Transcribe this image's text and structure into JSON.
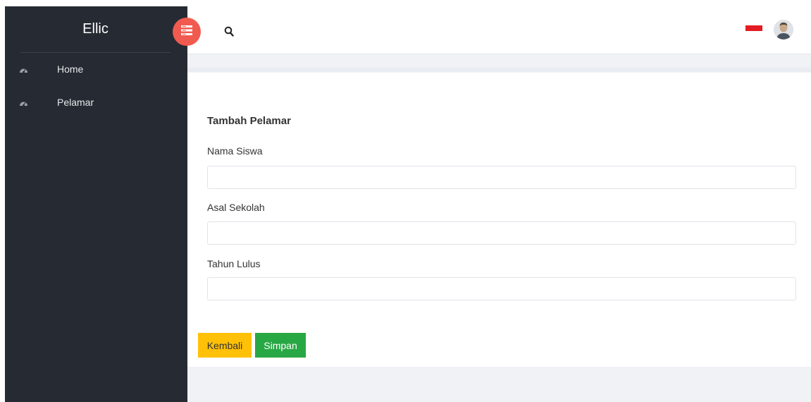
{
  "sidebar": {
    "brand": "Ellic",
    "items": [
      {
        "label": "Home",
        "icon": "dashboard-icon"
      },
      {
        "label": "Pelamar",
        "icon": "dashboard-icon"
      }
    ]
  },
  "topbar": {
    "toggle_icon": "menu-toggle-icon",
    "search_icon": "search-icon",
    "flag_icon": "flag-icon",
    "avatar_icon": "user-avatar"
  },
  "form": {
    "title": "Tambah Pelamar",
    "fields": [
      {
        "label": "Nama Siswa",
        "value": "",
        "placeholder": ""
      },
      {
        "label": "Asal Sekolah",
        "value": "",
        "placeholder": ""
      },
      {
        "label": "Tahun Lulus",
        "value": "",
        "placeholder": ""
      }
    ],
    "back_label": "Kembali",
    "save_label": "Simpan"
  },
  "colors": {
    "sidebar_bg": "#262b33",
    "toggle_bg": "#f15a4f",
    "back_button": "#ffc107",
    "save_button": "#28a745",
    "flag": "#e31c23"
  }
}
